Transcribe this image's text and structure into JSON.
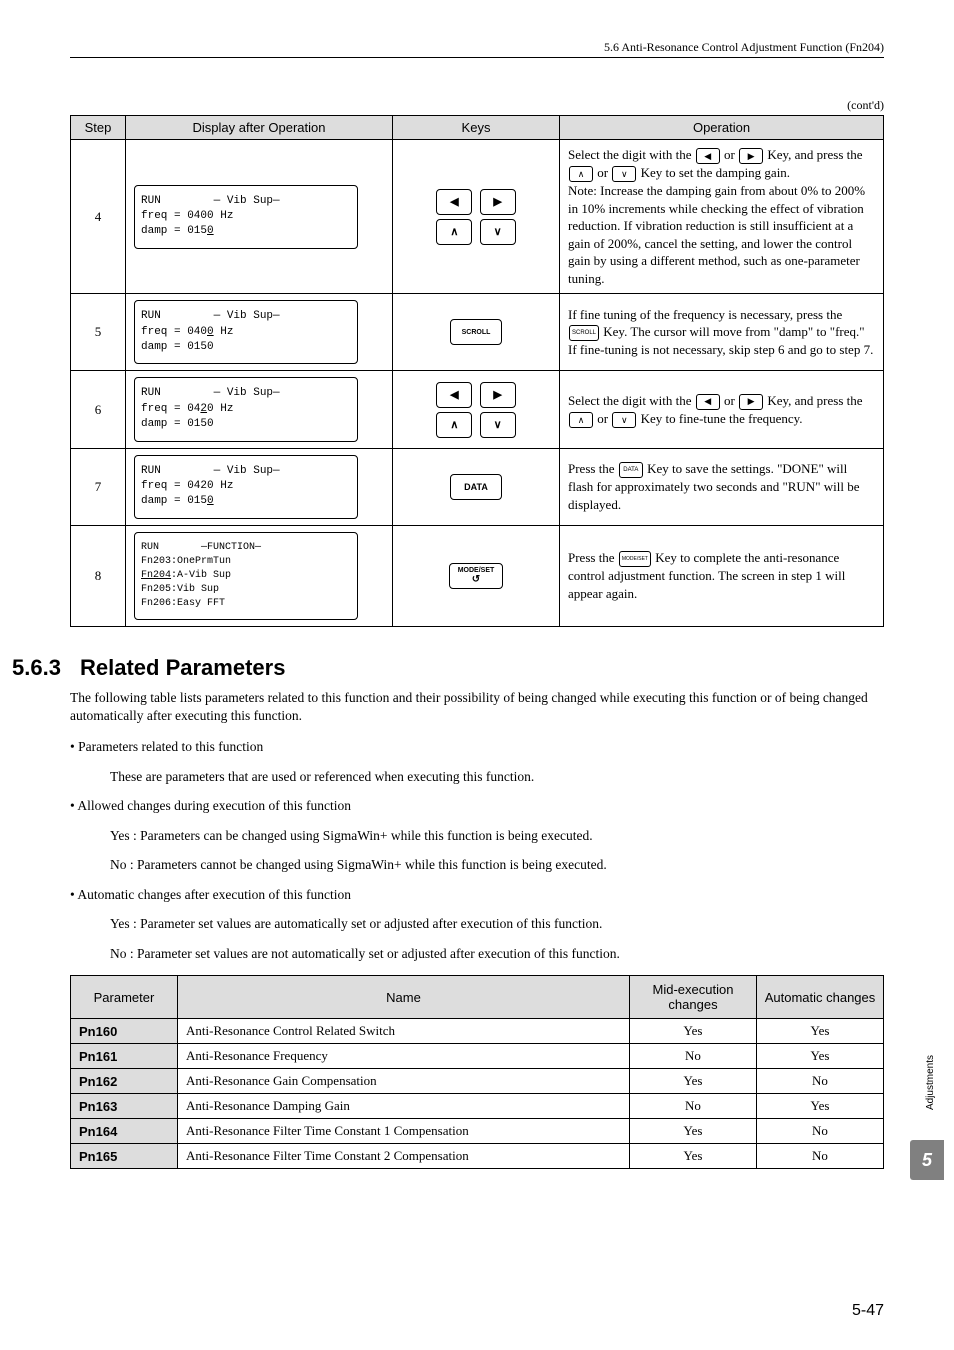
{
  "header": {
    "section_path": "5.6  Anti-Resonance Control Adjustment Function (Fn204)"
  },
  "contd": "(cont'd)",
  "op_table": {
    "headers": {
      "step": "Step",
      "display": "Display after Operation",
      "keys": "Keys",
      "operation": "Operation"
    }
  },
  "steps": {
    "s4": {
      "num": "4",
      "lcd": {
        "l1": "RUN        — Vib Sup—",
        "l2": "freq = 0400 Hz",
        "l3": "damp = 015",
        "l3u": "0"
      },
      "op": {
        "p1a": "Select the digit with the ",
        "p1b": " or ",
        "p1c": " Key, and press the ",
        "p1d": " or ",
        "p1e": " Key to set the damping gain.",
        "note_label": "Note:",
        "note": " Increase the damping gain from about 0% to 200% in 10% increments while checking the effect of vibration reduction. If vibration reduction is still insufficient at a gain of 200%, cancel the setting, and lower the control gain by using a different method, such as one-parameter tuning."
      }
    },
    "s5": {
      "num": "5",
      "lcd": {
        "l1": "RUN        — Vib Sup—",
        "l2a": "freq = 040",
        "l2u": "0",
        "l2b": " Hz",
        "l3": "damp = 0150"
      },
      "key_label": "SCROLL",
      "op": {
        "p1": "If fine tuning of the frequency is necessary, press the ",
        "key_text": "SCROLL",
        "p2": " Key. The cursor will move from \"damp\" to \"freq.\" If fine-tuning is not necessary, skip step 6 and go to step 7."
      }
    },
    "s6": {
      "num": "6",
      "lcd": {
        "l1": "RUN        — Vib Sup—",
        "l2a": "freq = 04",
        "l2u": "2",
        "l2b": "0 Hz",
        "l3": "damp = 0150"
      },
      "op": {
        "p1a": "Select the digit with the ",
        "p1b": " or ",
        "p1c": " Key, and press the ",
        "p1d": " or ",
        "p1e": " Key to fine-tune the frequency."
      }
    },
    "s7": {
      "num": "7",
      "lcd": {
        "l1": "RUN        — Vib Sup—",
        "l2": "freq = 0420 Hz",
        "l3a": "damp = 015",
        "l3u": "0"
      },
      "key_label": "DATA",
      "op": {
        "p1": "Press the ",
        "key_text": "DATA",
        "p2": " Key to save the settings. \"DONE\" will flash for approximately two seconds and \"RUN\" will be displayed."
      }
    },
    "s8": {
      "num": "8",
      "lcd": {
        "l1": "RUN       —FUNCTION—",
        "l2": "Fn203:OnePrmTun",
        "l3u": "Fn204",
        "l3b": ":A-Vib Sup",
        "l4": "Fn205:Vib Sup",
        "l5": "Fn206:Easy FFT"
      },
      "key_label": "MODE/SET",
      "op": {
        "p1": "Press the ",
        "key_text": "MODE/SET",
        "p2": " Key to complete the anti-resonance control adjustment function. The screen in step 1 will appear again."
      }
    }
  },
  "related": {
    "num": "5.6.3",
    "title": "Related Parameters",
    "intro": "The following table lists parameters related to this function and their possibility of being changed while executing this function or of being changed automatically after executing this function.",
    "b1": "• Parameters related to this function",
    "b1d": "These are parameters that are used or referenced when executing this function.",
    "b2": "• Allowed changes during execution of this function",
    "b2y": "Yes : Parameters can be changed using SigmaWin+ while this function is being executed.",
    "b2n": "No  : Parameters cannot be changed using SigmaWin+ while this function is being executed.",
    "b3": "• Automatic changes after execution of this function",
    "b3y": "Yes : Parameter set values are automatically set or adjusted after execution of this function.",
    "b3n": "No  : Parameter set values are not automatically set or adjusted after execution of this function."
  },
  "param_headers": {
    "param": "Parameter",
    "name": "Name",
    "mid": "Mid-execution changes",
    "auto": "Automatic changes"
  },
  "params": [
    {
      "pn": "Pn160",
      "name": "Anti-Resonance Control Related Switch",
      "mid": "Yes",
      "auto": "Yes"
    },
    {
      "pn": "Pn161",
      "name": "Anti-Resonance Frequency",
      "mid": "No",
      "auto": "Yes"
    },
    {
      "pn": "Pn162",
      "name": "Anti-Resonance Gain Compensation",
      "mid": "Yes",
      "auto": "No"
    },
    {
      "pn": "Pn163",
      "name": "Anti-Resonance Damping Gain",
      "mid": "No",
      "auto": "Yes"
    },
    {
      "pn": "Pn164",
      "name": "Anti-Resonance Filter Time Constant 1 Compensation",
      "mid": "Yes",
      "auto": "No"
    },
    {
      "pn": "Pn165",
      "name": "Anti-Resonance Filter Time Constant 2 Compensation",
      "mid": "Yes",
      "auto": "No"
    }
  ],
  "side_label": "Adjustments",
  "chapter_tab": "5",
  "page_number": "5-47",
  "glyphs": {
    "left": "◀",
    "right": "▶",
    "up": "∧",
    "down": "∨",
    "return": "↺"
  }
}
